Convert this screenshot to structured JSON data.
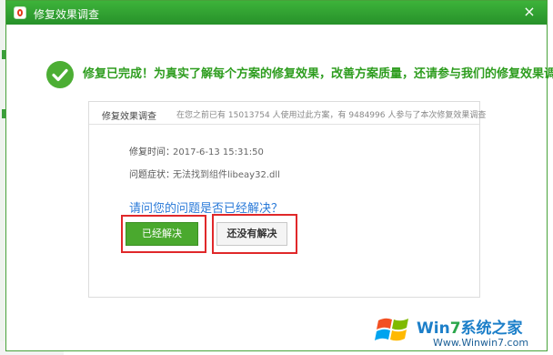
{
  "window": {
    "title": "修复效果调查",
    "close_label": "×"
  },
  "header": {
    "message": "修复已完成！为真实了解每个方案的修复效果，改善方案质量，还请参与我们的修复效果调查！"
  },
  "panel": {
    "title": "修复效果调查",
    "stats": "在您之前已有 15013754 人使用过此方案，有 9484996 人参与了本次修复效果调查"
  },
  "details": {
    "time_label": "修复时间：",
    "time_value": "2017-6-13 15:31:50",
    "symptom_label": "问题症状：",
    "symptom_value": "无法找到组件libeay32.dll"
  },
  "survey": {
    "question": "请问您的问题是否已经解决？",
    "solved_label": "已经解决",
    "unsolved_label": "还没有解决"
  },
  "watermark": {
    "brand_prefix": "Win",
    "brand_seven": "7",
    "brand_suffix": "系统之家",
    "url": "Www.Winwin7.com"
  },
  "colors": {
    "titlebar": "#2f9e2f",
    "accent_green": "#4aa92e",
    "question_blue": "#2a7ad8",
    "highlight_red": "#e0282a"
  }
}
